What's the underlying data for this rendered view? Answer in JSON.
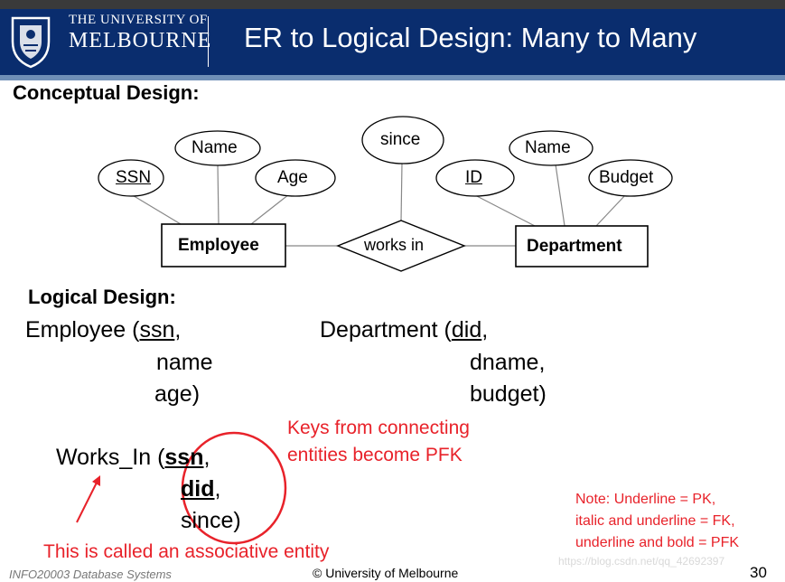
{
  "header": {
    "university_line1": "THE UNIVERSITY OF",
    "university_line2": "MELBOURNE",
    "title": "ER to Logical Design: Many to Many"
  },
  "conceptual": {
    "heading": "Conceptual Design:",
    "attributes": {
      "ssn": "SSN",
      "emp_name": "Name",
      "age": "Age",
      "since": "since",
      "id": "ID",
      "dept_name": "Name",
      "budget": "Budget"
    },
    "entities": {
      "employee": "Employee",
      "department": "Department"
    },
    "relationship": "works in"
  },
  "logical": {
    "heading": "Logical Design:",
    "employee": {
      "open": "Employee (",
      "key": "ssn",
      "key_suffix": ",",
      "line2": "name",
      "line3": "age)"
    },
    "department": {
      "open": "Department (",
      "key": "did",
      "key_suffix": ",",
      "line2": "dname,",
      "line3": "budget)"
    },
    "works_in": {
      "open": "Works_In (",
      "key1": "ssn",
      "key1_suffix": ",",
      "key2": "did",
      "key2_suffix": ",",
      "line3": "since)"
    }
  },
  "annotations": {
    "keys_line1": "Keys from connecting",
    "keys_line2": "entities become PFK",
    "associative": "This is called an associative entity",
    "note_line1": "Note: Underline = PK,",
    "note_line2": "italic and underline = FK,",
    "note_line3": "underline and bold = PFK"
  },
  "footer": {
    "course": "INFO20003 Database Systems",
    "copyright": "© University of Melbourne",
    "page": "30",
    "watermark": "https://blog.csdn.net/qq_42692397"
  },
  "colors": {
    "header_bg": "#0a2d6e",
    "header_underline": "#6f8fb7",
    "accent_red": "#e8222a"
  }
}
